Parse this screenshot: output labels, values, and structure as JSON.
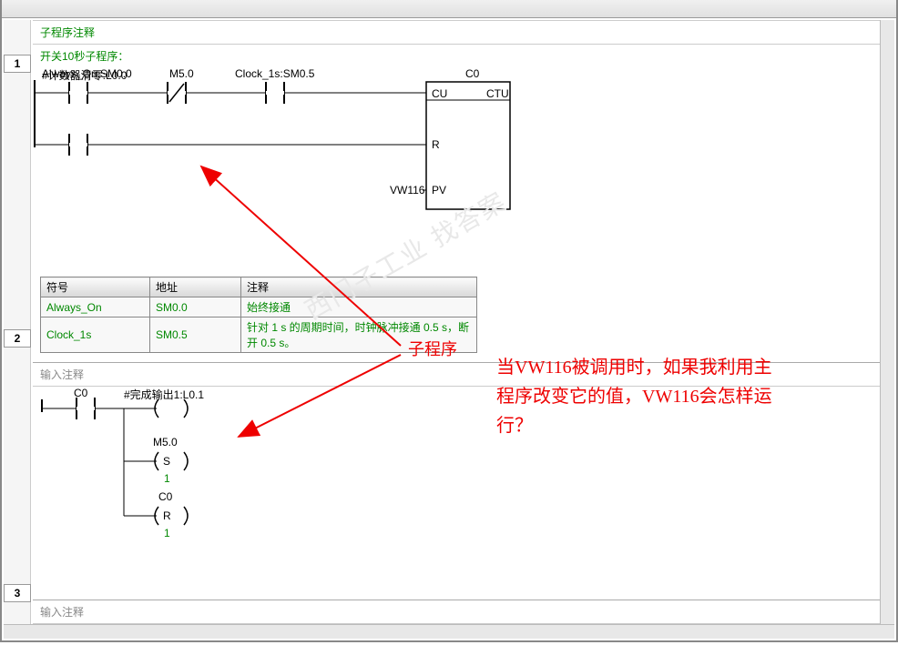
{
  "comments": {
    "sub_comment": "子程序注释",
    "enter_comment": "输入注释"
  },
  "network1": {
    "title": "开关10秒子程序：",
    "contact1": "Always_On:SM0.0",
    "contact2": "M5.0",
    "contact3": "Clock_1s:SM0.5",
    "reset_contact": "#计数器清零:L0.0",
    "counter_name": "C0",
    "counter_cu": "CU",
    "counter_type": "CTU",
    "counter_r": "R",
    "counter_pv": "PV",
    "counter_pv_val": "VW116"
  },
  "symtable": {
    "headers": {
      "sym": "符号",
      "addr": "地址",
      "note": "注释"
    },
    "rows": [
      {
        "sym": "Always_On",
        "addr": "SM0.0",
        "note": "始终接通"
      },
      {
        "sym": "Clock_1s",
        "addr": "SM0.5",
        "note": "针对 1 s 的周期时间，时钟脉冲接通 0.5 s，断开 0.5 s。"
      }
    ]
  },
  "network2": {
    "contact": "C0",
    "coil1": "#完成输出1:L0.1",
    "coil2_name": "M5.0",
    "coil2_type": "S",
    "coil2_val": "1",
    "coil3_name": "C0",
    "coil3_type": "R",
    "coil3_val": "1"
  },
  "annotation": {
    "label": "子程序",
    "text_l1": "当VW116被调用时，如果我利用主",
    "text_l2": "程序改变它的值，VW116会怎样运",
    "text_l3": "行？"
  },
  "rung_numbers": {
    "n1": "1",
    "n2": "2",
    "n3": "3"
  },
  "watermark": "西门子工业 找答案"
}
